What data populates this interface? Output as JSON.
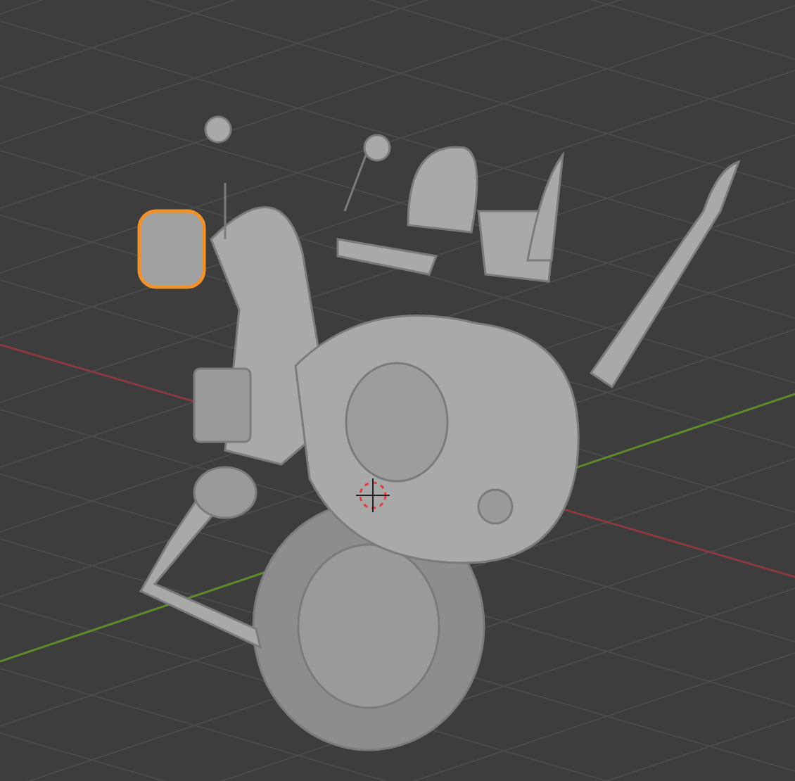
{
  "viewport": {
    "show_grid": true,
    "show_axes": true,
    "show_cursor": true
  },
  "headlight": {
    "selected": true
  }
}
